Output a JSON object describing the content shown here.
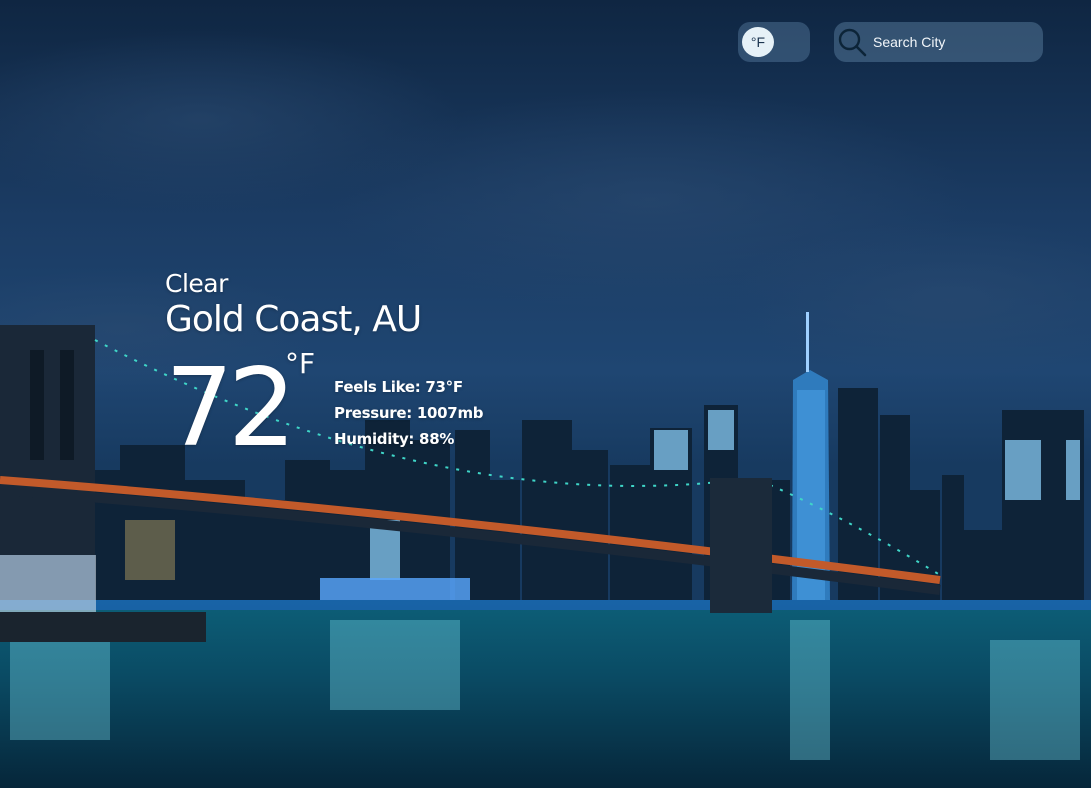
{
  "controls": {
    "unit_toggle_label": "°F",
    "search_placeholder": "Search City"
  },
  "weather": {
    "condition": "Clear",
    "location": "Gold Coast, AU",
    "temperature": "72",
    "unit": "°F",
    "feels_like_label": "Feels Like: 73°F",
    "pressure_label": "Pressure: 1007mb",
    "humidity_label": "Humidity: 88%"
  },
  "colors": {
    "toggle_knob": "#e6f1f7",
    "control_bg": "#4a6e8f",
    "text": "#ffffff"
  },
  "icons": {
    "search": "search-icon"
  }
}
